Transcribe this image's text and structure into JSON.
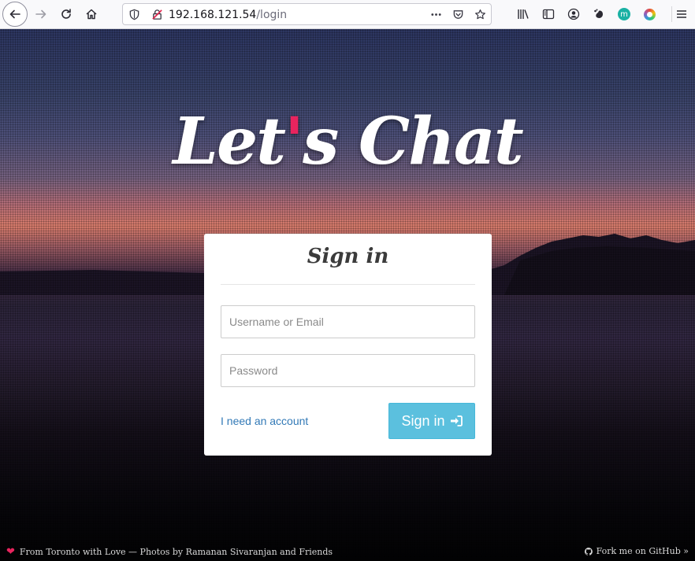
{
  "browser": {
    "url_host": "192.168.121.54",
    "url_path": "/login",
    "toolbar_icons": [
      "back-icon",
      "forward-icon",
      "reload-icon",
      "home-icon",
      "shield-icon",
      "insecure-lock-icon",
      "more-icon",
      "pocket-icon",
      "bookmark-star-icon",
      "library-icon",
      "sidebar-icon",
      "account-icon",
      "gnome-extension-icon",
      "m-extension-icon",
      "color-extension-icon",
      "menu-icon"
    ],
    "extension_m_label": "m"
  },
  "logo": {
    "text_before": "Let",
    "apostrophe": "'",
    "text_after": "s Chat"
  },
  "signin": {
    "title": "Sign in",
    "username_placeholder": "Username or Email",
    "password_placeholder": "Password",
    "account_link": "I need an account",
    "button_label": "Sign in",
    "button_icon": "sign-in-icon"
  },
  "footer": {
    "left_icon": "heart-icon",
    "left_text": "From Toronto with Love — Photos by Ramanan Sivaranjan and Friends",
    "right_icon": "github-icon",
    "right_text": "Fork me on GitHub »"
  },
  "colors": {
    "accent_pink": "#e8245e",
    "button_info": "#5bc0de",
    "link_blue": "#337ab7"
  }
}
